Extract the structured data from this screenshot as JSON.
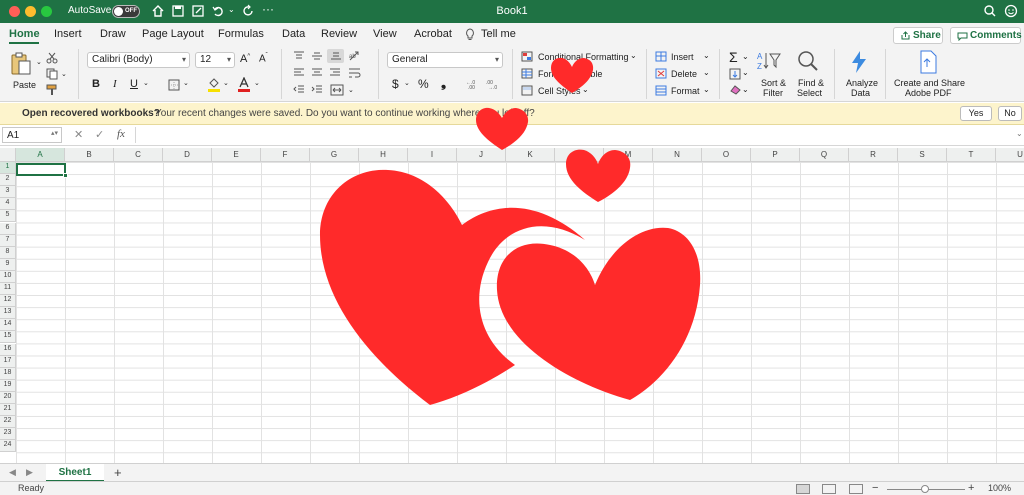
{
  "titlebar": {
    "autosave_label": "AutoSave",
    "autosave_state": "OFF",
    "title": "Book1"
  },
  "tabs": [
    "Home",
    "Insert",
    "Draw",
    "Page Layout",
    "Formulas",
    "Data",
    "Review",
    "View",
    "Acrobat",
    "Tell me"
  ],
  "actions": {
    "share": "Share",
    "comments": "Comments"
  },
  "ribbon": {
    "paste": "Paste",
    "font_name": "Calibri (Body)",
    "font_size": "12",
    "number_format": "General",
    "bold": "B",
    "italic": "I",
    "underline": "U",
    "currency": "$",
    "percent": "%",
    "comma": "❟",
    "conditional_formatting": "Conditional Formatting",
    "format_as_table": "Format as Table",
    "cell_styles": "Cell Styles",
    "insert": "Insert",
    "delete": "Delete",
    "format": "Format",
    "sort_filter_1": "Sort &",
    "sort_filter_2": "Filter",
    "find_select_1": "Find &",
    "find_select_2": "Select",
    "analyze_1": "Analyze",
    "analyze_2": "Data",
    "create_share_1": "Create and Share",
    "create_share_2": "Adobe PDF"
  },
  "notification": {
    "title": "Open recovered workbooks?",
    "message": "Your recent changes were saved. Do you want to continue working where you left off?",
    "yes": "Yes",
    "no": "No"
  },
  "formula_bar": {
    "name_box": "A1",
    "fx": "fx",
    "value": ""
  },
  "grid": {
    "columns": [
      "A",
      "B",
      "C",
      "D",
      "E",
      "F",
      "G",
      "H",
      "I",
      "J",
      "K",
      "L",
      "M",
      "N",
      "O",
      "P",
      "Q",
      "R",
      "S",
      "T",
      "U"
    ],
    "rows": [
      "1",
      "2",
      "3",
      "4",
      "5",
      "6",
      "7",
      "8",
      "9",
      "10",
      "11",
      "12",
      "13",
      "14",
      "15",
      "16",
      "17",
      "18",
      "19",
      "20",
      "21",
      "22",
      "23",
      "24"
    ],
    "selected_cell": "A1"
  },
  "sheets": {
    "tabs": [
      "Sheet1"
    ],
    "add": "+"
  },
  "status": {
    "text": "Ready",
    "zoom": "100%"
  },
  "colors": {
    "accent": "#1f7244",
    "heart": "#ff2a2a",
    "notification_bg": "#fdf4cc"
  }
}
